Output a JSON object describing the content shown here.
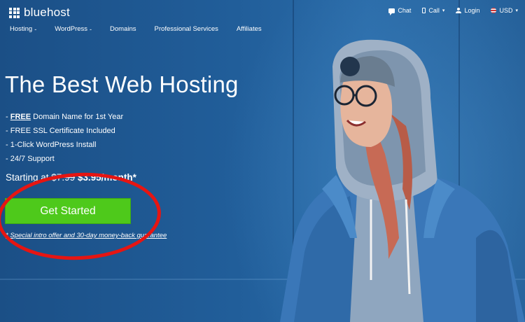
{
  "brand": {
    "name": "bluehost"
  },
  "utility_nav": [
    {
      "label": "Chat",
      "icon": "chat-icon"
    },
    {
      "label": "Call",
      "icon": "phone-icon",
      "has_caret": true
    },
    {
      "label": "Login",
      "icon": "user-icon"
    },
    {
      "label": "USD",
      "icon": "us-flag-icon",
      "has_caret": true
    }
  ],
  "main_nav": [
    {
      "label": "Hosting",
      "suffix": "-"
    },
    {
      "label": "WordPress",
      "suffix": "-"
    },
    {
      "label": "Domains",
      "suffix": ""
    },
    {
      "label": "Professional Services",
      "suffix": ""
    },
    {
      "label": "Affiliates",
      "suffix": ""
    }
  ],
  "hero": {
    "title": "The Best Web Hosting",
    "features": [
      {
        "bullet": "-",
        "bold": "FREE",
        "text": " Domain Name for 1st Year"
      },
      {
        "bullet": "-",
        "bold": "",
        "text": "FREE SSL Certificate Included"
      },
      {
        "bullet": "-",
        "bold": "",
        "text": "1-Click WordPress Install"
      },
      {
        "bullet": "-",
        "bold": "",
        "text": "24/7 Support"
      }
    ],
    "price_prefix": "Starting at ",
    "price_old": "$7.99",
    "price_new": "$3.95/month*",
    "cta_label": "Get Started",
    "disclaimer": "* Special intro offer and 30-day money-back guarantee"
  },
  "colors": {
    "background": "#1e5a94",
    "cta_green": "#4ec91b",
    "annotation_red": "#e61512"
  }
}
